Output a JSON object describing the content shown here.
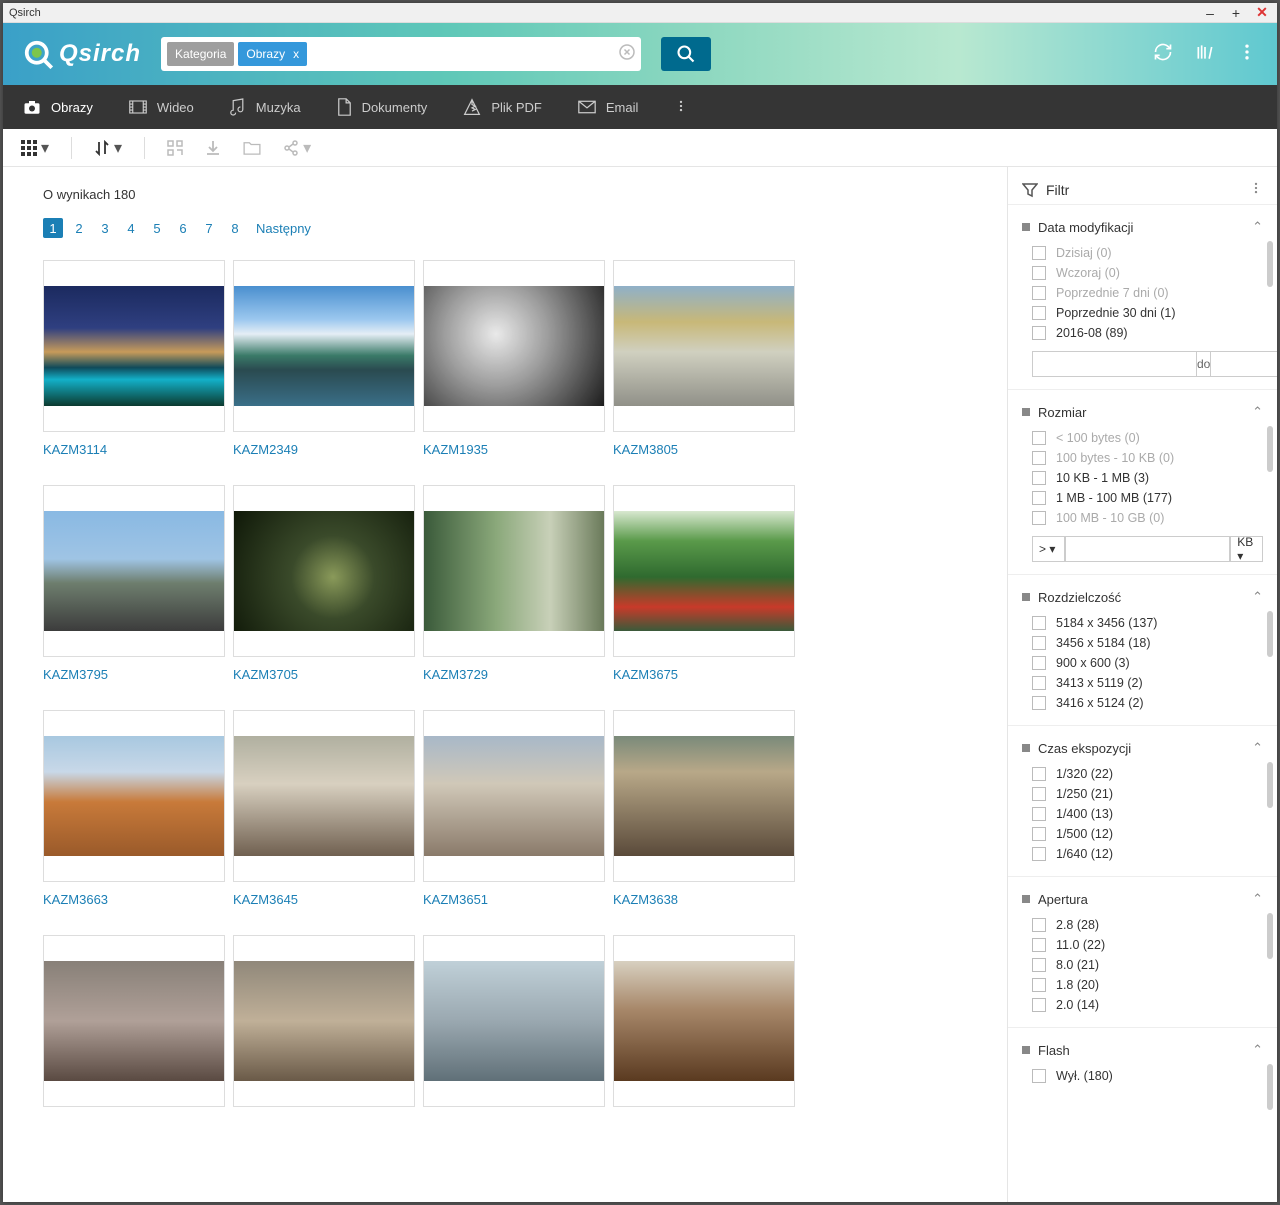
{
  "window": {
    "title": "Qsirch"
  },
  "logo": "Qsirch",
  "search": {
    "category_label": "Kategoria",
    "category_value": "Obrazy"
  },
  "nav": [
    {
      "label": "Obrazy",
      "active": true
    },
    {
      "label": "Wideo"
    },
    {
      "label": "Muzyka"
    },
    {
      "label": "Dokumenty"
    },
    {
      "label": "Plik PDF"
    },
    {
      "label": "Email"
    }
  ],
  "results": {
    "label": "O wynikach 180",
    "pages": [
      "1",
      "2",
      "3",
      "4",
      "5",
      "6",
      "7",
      "8"
    ],
    "next_label": "Następny",
    "current_page": 1,
    "items": [
      {
        "name": "KAZM3114",
        "thumb": "t1"
      },
      {
        "name": "KAZM2349",
        "thumb": "t2"
      },
      {
        "name": "KAZM1935",
        "thumb": "t3"
      },
      {
        "name": "KAZM3805",
        "thumb": "t4"
      },
      {
        "name": "KAZM3795",
        "thumb": "t5"
      },
      {
        "name": "KAZM3705",
        "thumb": "t6"
      },
      {
        "name": "KAZM3729",
        "thumb": "t7"
      },
      {
        "name": "KAZM3675",
        "thumb": "t8"
      },
      {
        "name": "KAZM3663",
        "thumb": "t9"
      },
      {
        "name": "KAZM3645",
        "thumb": "t10"
      },
      {
        "name": "KAZM3651",
        "thumb": "t11"
      },
      {
        "name": "KAZM3638",
        "thumb": "t12"
      },
      {
        "name": "",
        "thumb": "t13"
      },
      {
        "name": "",
        "thumb": "t14"
      },
      {
        "name": "",
        "thumb": "t15"
      },
      {
        "name": "",
        "thumb": "t16"
      }
    ]
  },
  "filter": {
    "label": "Filtr",
    "date": {
      "title": "Data modyfikacji",
      "opts": [
        {
          "label": "Dzisiaj (0)",
          "disabled": true
        },
        {
          "label": "Wczoraj (0)",
          "disabled": true
        },
        {
          "label": "Poprzednie 7 dni (0)",
          "disabled": true
        },
        {
          "label": "Poprzednie 30 dni (1)"
        },
        {
          "label": "2016-08 (89)"
        }
      ],
      "range_mid": "do"
    },
    "size": {
      "title": "Rozmiar",
      "opts": [
        {
          "label": "< 100 bytes (0)",
          "disabled": true
        },
        {
          "label": "100 bytes - 10 KB (0)",
          "disabled": true
        },
        {
          "label": "10 KB - 1 MB (3)"
        },
        {
          "label": "1 MB - 100 MB (177)"
        },
        {
          "label": "100 MB - 10 GB (0)",
          "disabled": true
        }
      ],
      "unit": "KB"
    },
    "resolution": {
      "title": "Rozdzielczość",
      "opts": [
        {
          "label": "5184 x 3456 (137)"
        },
        {
          "label": "3456 x 5184 (18)"
        },
        {
          "label": "900 x 600 (3)"
        },
        {
          "label": "3413 x 5119 (2)"
        },
        {
          "label": "3416 x 5124 (2)"
        }
      ]
    },
    "exposure": {
      "title": "Czas ekspozycji",
      "opts": [
        {
          "label": "1/320 (22)"
        },
        {
          "label": "1/250 (21)"
        },
        {
          "label": "1/400 (13)"
        },
        {
          "label": "1/500 (12)"
        },
        {
          "label": "1/640 (12)"
        }
      ]
    },
    "aperture": {
      "title": "Apertura",
      "opts": [
        {
          "label": "2.8 (28)"
        },
        {
          "label": "11.0 (22)"
        },
        {
          "label": "8.0 (21)"
        },
        {
          "label": "1.8 (20)"
        },
        {
          "label": "2.0 (14)"
        }
      ]
    },
    "flash": {
      "title": "Flash",
      "opts": [
        {
          "label": "Wył. (180)"
        }
      ]
    }
  }
}
